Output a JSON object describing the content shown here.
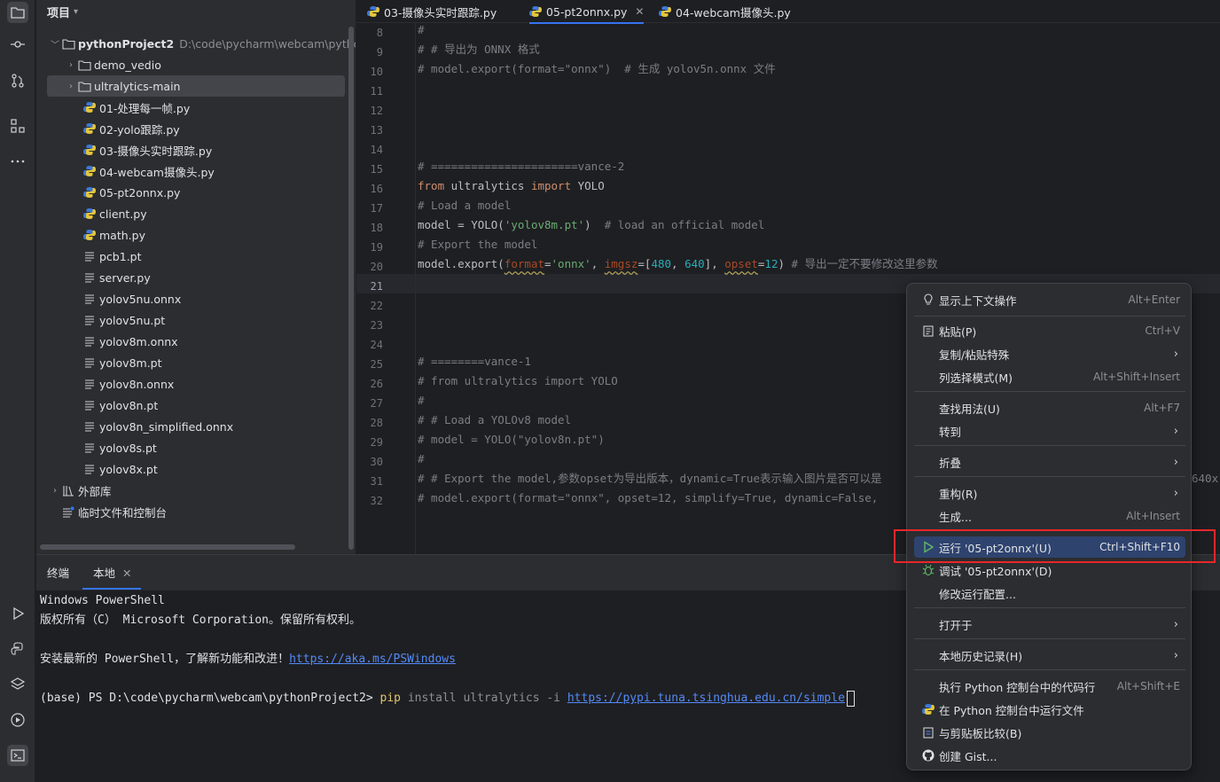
{
  "project": {
    "title": "项目",
    "root": {
      "name": "pythonProject2",
      "path": "D:\\code\\pycharm\\webcam\\pythonP"
    },
    "folders": [
      "demo_vedio",
      "ultralytics-main"
    ],
    "files": [
      {
        "name": "01-处理每一帧.py",
        "kind": "py"
      },
      {
        "name": "02-yolo跟踪.py",
        "kind": "py"
      },
      {
        "name": "03-摄像头实时跟踪.py",
        "kind": "py"
      },
      {
        "name": "04-webcam摄像头.py",
        "kind": "py"
      },
      {
        "name": "05-pt2onnx.py",
        "kind": "py"
      },
      {
        "name": "client.py",
        "kind": "py"
      },
      {
        "name": "math.py",
        "kind": "py"
      },
      {
        "name": "pcb1.pt",
        "kind": "txt"
      },
      {
        "name": "server.py",
        "kind": "txt"
      },
      {
        "name": "yolov5nu.onnx",
        "kind": "txt"
      },
      {
        "name": "yolov5nu.pt",
        "kind": "txt"
      },
      {
        "name": "yolov8m.onnx",
        "kind": "txt"
      },
      {
        "name": "yolov8m.pt",
        "kind": "txt"
      },
      {
        "name": "yolov8n.onnx",
        "kind": "txt"
      },
      {
        "name": "yolov8n.pt",
        "kind": "txt"
      },
      {
        "name": "yolov8n_simplified.onnx",
        "kind": "txt"
      },
      {
        "name": "yolov8s.pt",
        "kind": "txt"
      },
      {
        "name": "yolov8x.pt",
        "kind": "txt"
      }
    ],
    "external_libs": "外部库",
    "scratches": "临时文件和控制台"
  },
  "tabs": [
    {
      "label": "03-摄像头实时跟踪.py"
    },
    {
      "label": "05-pt2onnx.py"
    },
    {
      "label": "04-webcam摄像头.py"
    }
  ],
  "editor": {
    "line_numbers": [
      "8",
      "9",
      "10",
      "11",
      "12",
      "13",
      "14",
      "15",
      "16",
      "17",
      "18",
      "19",
      "20",
      "21",
      "22",
      "23",
      "24",
      "25",
      "26",
      "27",
      "28",
      "29",
      "30",
      "31",
      "32"
    ],
    "current_line": "21",
    "code": {
      "l8": "#",
      "l9": "# # 导出为 ONNX 格式",
      "l10": "# model.export(format=\"onnx\")  # 生成 yolov5n.onnx 文件",
      "l15": "# ======================vance-2",
      "l16a": "from",
      "l16b": " ultralytics ",
      "l16c": "import",
      "l16d": " YOLO",
      "l17": "# Load a model",
      "l18a": "model = YOLO(",
      "l18b": "'yolov8m.pt'",
      "l18c": ")  ",
      "l18d": "# load an official model",
      "l19": "# Export the model",
      "l20a": "model.export(",
      "l20b": "format",
      "l20c": "=",
      "l20d": "'onnx'",
      "l20e": ", ",
      "l20f": "imgsz",
      "l20g": "=[",
      "l20h": "480",
      "l20i": ", ",
      "l20j": "640",
      "l20k": "], ",
      "l20l": "opset",
      "l20m": "=",
      "l20n": "12",
      "l20o": ") ",
      "l20p": "# 导出一定不要修改这里参数",
      "l25": "# ========vance-1",
      "l26": "# from ultralytics import YOLO",
      "l27": "#",
      "l28": "# # Load a YOLOv8 model",
      "l29": "# model = YOLO(\"yolov8n.pt\")",
      "l30": "#",
      "l31": "# # Export the model,参数opset为导出版本，dynamic=True表示输入图片是否可以是",
      "l31tail": "640x",
      "l32": "# model.export(format=\"onnx\", opset=12, simplify=True, dynamic=False,"
    }
  },
  "terminal": {
    "tabs": [
      "终端",
      "本地"
    ],
    "lines": {
      "t1": "Windows PowerShell",
      "t2": "版权所有（C） Microsoft Corporation。保留所有权利。",
      "t3a": "安装最新的 PowerShell，了解新功能和改进！",
      "t3b": "https://aka.ms/PSWindows",
      "t4a": "(base) PS D:\\code\\pycharm\\webcam\\pythonProject2> ",
      "t4b": "pip",
      "t4c": " install ultralytics -i ",
      "t4d": "https://pypi.tuna.tsinghua.edu.cn/simple"
    }
  },
  "menu": {
    "items": [
      {
        "label": "显示上下文操作",
        "shortcut": "Alt+Enter"
      },
      {
        "label": "粘贴(P)",
        "shortcut": "Ctrl+V"
      },
      {
        "label": "复制/粘贴特殊",
        "shortcut": ""
      },
      {
        "label": "列选择模式(M)",
        "shortcut": "Alt+Shift+Insert"
      },
      {
        "label": "查找用法(U)",
        "shortcut": "Alt+F7"
      },
      {
        "label": "转到",
        "shortcut": ""
      },
      {
        "label": "折叠",
        "shortcut": ""
      },
      {
        "label": "重构(R)",
        "shortcut": ""
      },
      {
        "label": "生成...",
        "shortcut": "Alt+Insert"
      },
      {
        "label": "运行 '05-pt2onnx'(U)",
        "shortcut": "Ctrl+Shift+F10"
      },
      {
        "label": "调试 '05-pt2onnx'(D)",
        "shortcut": ""
      },
      {
        "label": "修改运行配置...",
        "shortcut": ""
      },
      {
        "label": "打开于",
        "shortcut": ""
      },
      {
        "label": "本地历史记录(H)",
        "shortcut": ""
      },
      {
        "label": "执行 Python 控制台中的代码行",
        "shortcut": "Alt+Shift+E"
      },
      {
        "label": "在 Python 控制台中运行文件",
        "shortcut": ""
      },
      {
        "label": "与剪贴板比较(B)",
        "shortcut": ""
      },
      {
        "label": "创建 Gist...",
        "shortcut": ""
      }
    ]
  },
  "colors": {
    "accent": "#3574f0",
    "highlight": "#2e436e",
    "annotation": "#e8262b"
  }
}
